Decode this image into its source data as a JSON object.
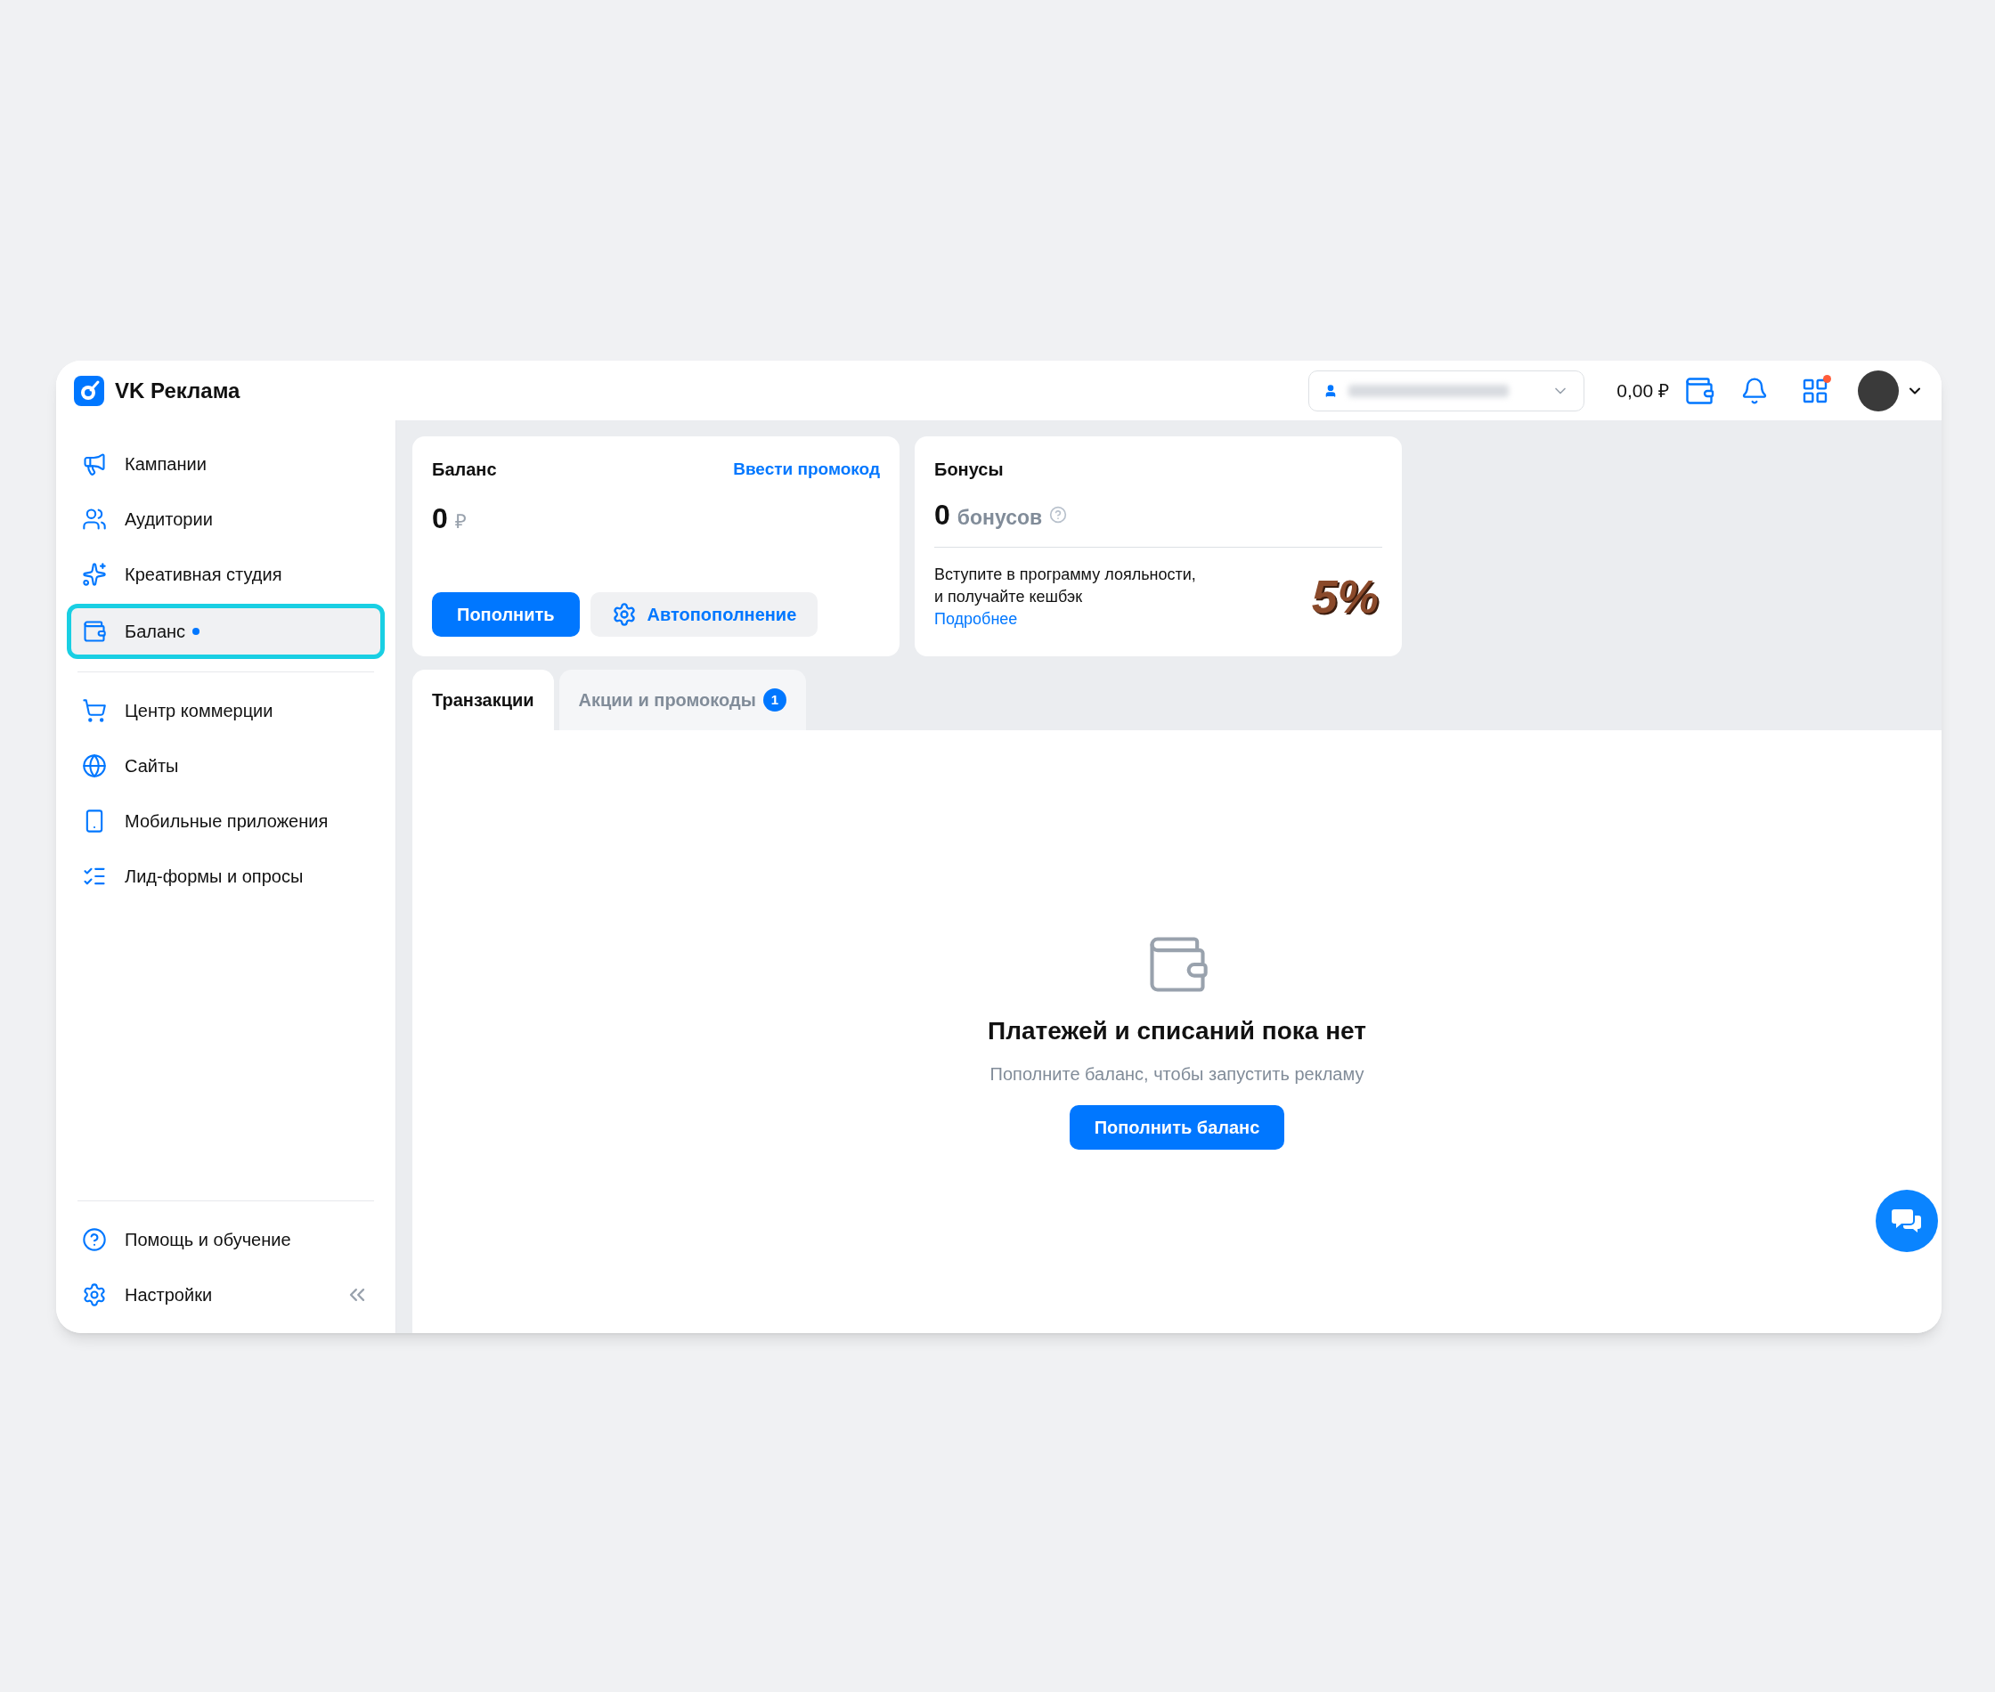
{
  "header": {
    "title": "VK Реклама",
    "balance": "0,00 ₽",
    "apps_notification": true
  },
  "sidebar": {
    "items": [
      {
        "label": "Кампании",
        "selected": false,
        "dot": false
      },
      {
        "label": "Аудитории",
        "selected": false,
        "dot": false
      },
      {
        "label": "Креативная студия",
        "selected": false,
        "dot": false
      },
      {
        "label": "Баланс",
        "selected": true,
        "dot": true
      },
      {
        "label": "Центр коммерции",
        "selected": false,
        "dot": false
      },
      {
        "label": "Сайты",
        "selected": false,
        "dot": false
      },
      {
        "label": "Мобильные приложения",
        "selected": false,
        "dot": false
      },
      {
        "label": "Лид-формы и опросы",
        "selected": false,
        "dot": false
      }
    ],
    "footer": [
      {
        "label": "Помощь и обучение"
      },
      {
        "label": "Настройки"
      }
    ]
  },
  "balance_card": {
    "title": "Баланс",
    "promo_link": "Ввести промокод",
    "amount": "0",
    "currency": "₽",
    "topup_button": "Пополнить",
    "auto_button": "Автопополнение"
  },
  "bonus_card": {
    "title": "Бонусы",
    "amount": "0",
    "unit": "бонусов",
    "text_line1": "Вступите в программу лояльности,",
    "text_line2": "и получайте кешбэк",
    "link": "Подробнее",
    "promo": "5%"
  },
  "tabs": [
    {
      "label": "Транзакции",
      "selected": true
    },
    {
      "label": "Акции и промокоды",
      "selected": false,
      "badge": "1"
    }
  ],
  "empty_state": {
    "title": "Платежей и списаний пока нет",
    "subtitle": "Пополните баланс, чтобы запустить рекламу",
    "button": "Пополнить баланс"
  }
}
